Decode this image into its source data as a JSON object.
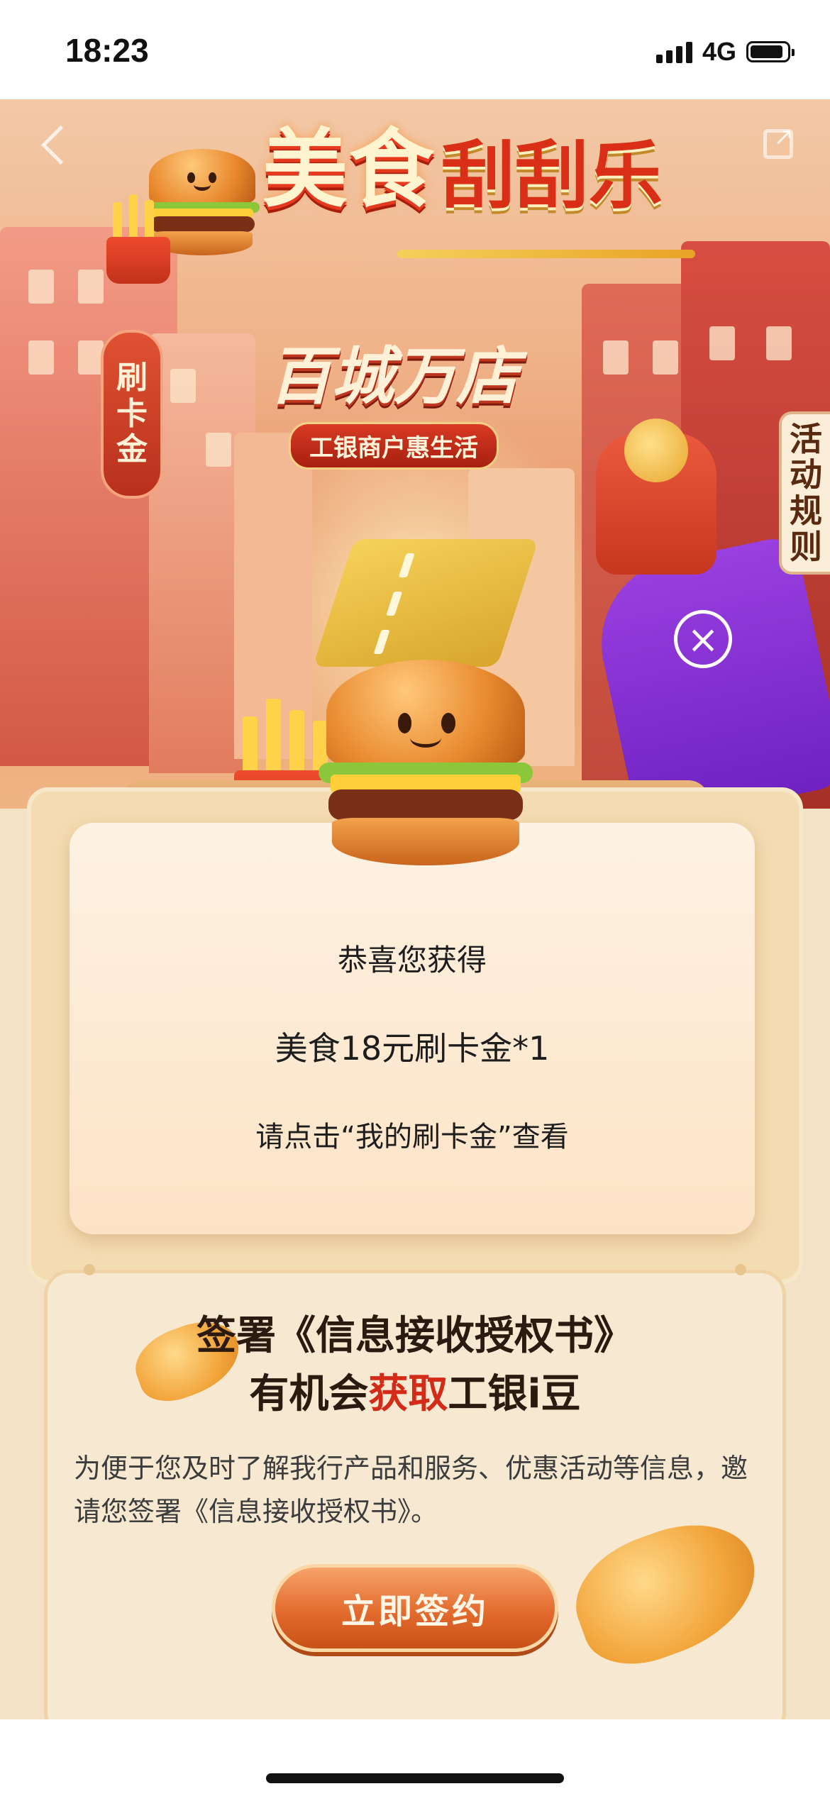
{
  "status_bar": {
    "time": "18:23",
    "network": "4G"
  },
  "hero": {
    "title_main": "美食",
    "title_sub": "刮刮乐",
    "slogan": "百城万店",
    "slogan_sub": "工银商户惠生活",
    "side_tag": "活动规则",
    "sign_card": "刷卡金",
    "close_symbol": "×"
  },
  "result": {
    "congrats": "恭喜您获得",
    "prize": "美食18元刷卡金*1",
    "hint": "请点击“我的刷卡金”查看"
  },
  "agreement": {
    "title_line1": "签署《信息接收授权书》",
    "title_line2_prefix": "有机会",
    "title_line2_highlight": "获取",
    "title_line2_suffix": "工银i豆",
    "description": "为便于您及时了解我行产品和服务、优惠活动等信息，邀请您签署《信息接收授权书》。",
    "button_label": "立即签约"
  },
  "colors": {
    "accent_red": "#d42a18",
    "button_orange": "#e36b2e",
    "card_bg": "#fde3c5"
  },
  "icons": [
    "back-icon",
    "share-icon",
    "close-icon",
    "signal-icon",
    "battery-icon"
  ]
}
